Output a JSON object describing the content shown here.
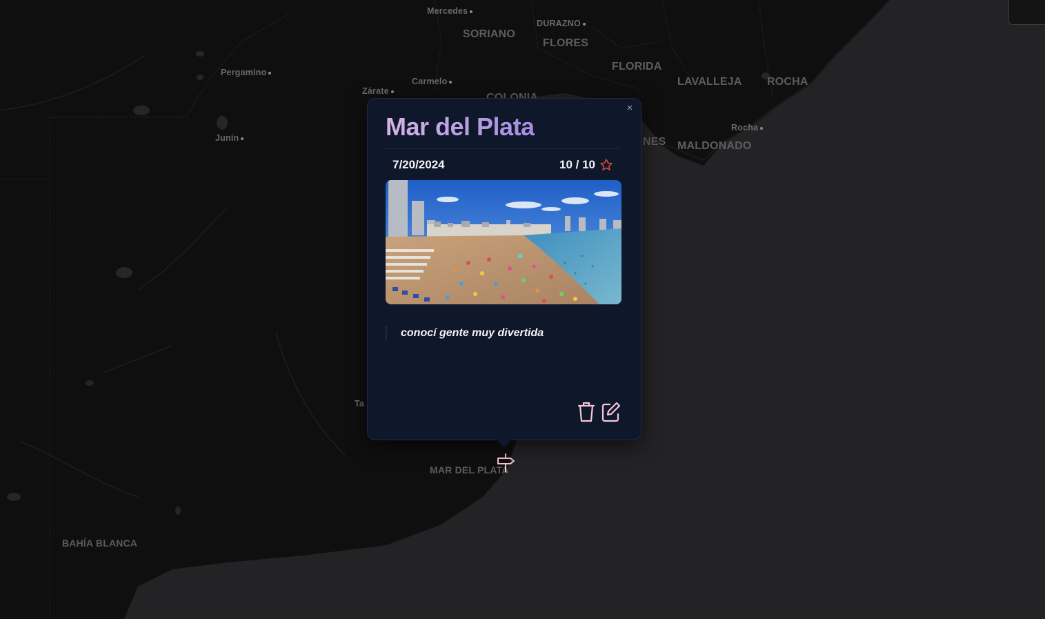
{
  "map": {
    "regions": [
      {
        "id": "soriano",
        "label": "SORIANO"
      },
      {
        "id": "flores",
        "label": "FLORES"
      },
      {
        "id": "florida",
        "label": "FLORIDA"
      },
      {
        "id": "lavalleja",
        "label": "LAVALLEJA"
      },
      {
        "id": "rocha",
        "label": "ROCHA"
      },
      {
        "id": "colonia",
        "label": "COLONIA"
      },
      {
        "id": "maldonado",
        "label": "MALDONADO"
      },
      {
        "id": "canelones-partial",
        "label": "NES"
      }
    ],
    "cities": [
      {
        "id": "mercedes",
        "label": "Mercedes"
      },
      {
        "id": "durazno",
        "label": "DURAZNO"
      },
      {
        "id": "pergamino",
        "label": "Pergamino"
      },
      {
        "id": "carmelo",
        "label": "Carmelo"
      },
      {
        "id": "zarate",
        "label": "Zárate"
      },
      {
        "id": "junin",
        "label": "Junín"
      },
      {
        "id": "rocha-city",
        "label": "Rocha"
      },
      {
        "id": "tandil-partial",
        "label": "Ta"
      },
      {
        "id": "mar-del-plata",
        "label": "MAR DEL PLATA"
      },
      {
        "id": "bahia-blanca",
        "label": "BAHÍA BLANCA"
      }
    ]
  },
  "popup": {
    "title": "Mar del Plata",
    "date": "7/20/2024",
    "rating": "10 / 10",
    "note": "conocí gente muy divertida",
    "close_label": "×",
    "photo_alt": "beach photo"
  },
  "icons": {
    "rating": "star-icon",
    "delete": "trash-icon",
    "edit": "edit-icon",
    "marker": "signpost-icon",
    "close": "close-icon"
  },
  "colors": {
    "popup_bg": "#0f172a",
    "title_gradient_start": "#d6b4e6",
    "title_gradient_end": "#a48fe0",
    "star": "#e0483b",
    "action_icons": "#f6c6da",
    "map_bg": "#0f0f10"
  }
}
